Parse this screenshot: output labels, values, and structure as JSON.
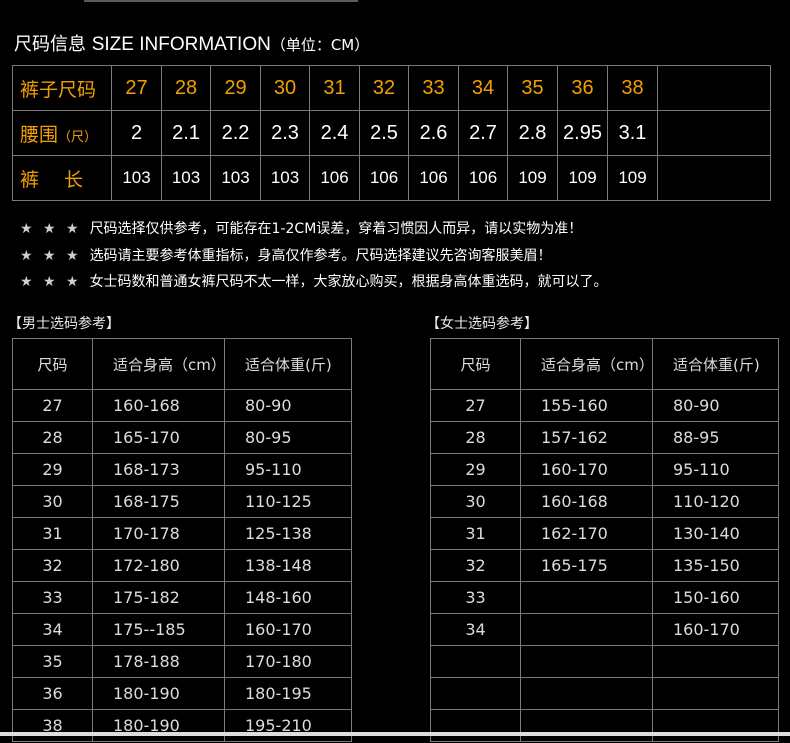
{
  "title": {
    "cn": "尺码信息",
    "en": "SIZE INFORMATION",
    "unit": "（单位：CM）"
  },
  "size_table": {
    "row_labels": {
      "size": "裤子尺码",
      "waist_cn": "腰围",
      "waist_unit": "（尺）",
      "length": "裤　 长"
    },
    "sizes": [
      "27",
      "28",
      "29",
      "30",
      "31",
      "32",
      "33",
      "34",
      "35",
      "36",
      "38"
    ],
    "waist": [
      "2",
      "2.1",
      "2.2",
      "2.3",
      "2.4",
      "2.5",
      "2.6",
      "2.7",
      "2.8",
      "2.95",
      "3.1"
    ],
    "length": [
      "103",
      "103",
      "103",
      "103",
      "106",
      "106",
      "106",
      "106",
      "109",
      "109",
      "109"
    ]
  },
  "notes": {
    "stars": "★ ★ ★",
    "lines": [
      "尺码选择仅供参考，可能存在1-2CM误差，穿着习惯因人而异，请以实物为准！",
      "选码请主要参考体重指标，身高仅作参考。尺码选择建议先咨询客服美眉！",
      "女士码数和普通女裤尺码不太一样，大家放心购买，根据身高体重选码，就可以了。"
    ]
  },
  "men": {
    "label": "【男士选码参考】",
    "headers": [
      "尺码",
      "适合身高（cm）",
      "适合体重(斤)"
    ],
    "rows": [
      [
        "27",
        "160-168",
        "80-90"
      ],
      [
        "28",
        "165-170",
        "80-95"
      ],
      [
        "29",
        "168-173",
        "95-110"
      ],
      [
        "30",
        "168-175",
        "110-125"
      ],
      [
        "31",
        "170-178",
        "125-138"
      ],
      [
        "32",
        "172-180",
        "138-148"
      ],
      [
        "33",
        "175-182",
        "148-160"
      ],
      [
        "34",
        "175--185",
        "160-170"
      ],
      [
        "35",
        "178-188",
        "170-180"
      ],
      [
        "36",
        "180-190",
        "180-195"
      ],
      [
        "38",
        "180-190",
        "195-210"
      ]
    ]
  },
  "women": {
    "label": "【女士选码参考】",
    "headers": [
      "尺码",
      "适合身高（cm）",
      "适合体重(斤)"
    ],
    "rows": [
      [
        "27",
        "155-160",
        "80-90"
      ],
      [
        "28",
        "157-162",
        "88-95"
      ],
      [
        "29",
        "160-170",
        "95-110"
      ],
      [
        "30",
        "160-168",
        "110-120"
      ],
      [
        "31",
        "162-170",
        "130-140"
      ],
      [
        "32",
        "165-175",
        "135-150"
      ],
      [
        "33",
        "",
        "150-160"
      ],
      [
        "34",
        "",
        "160-170"
      ],
      [
        "",
        "",
        ""
      ],
      [
        "",
        "",
        ""
      ],
      [
        "",
        "",
        ""
      ]
    ]
  }
}
